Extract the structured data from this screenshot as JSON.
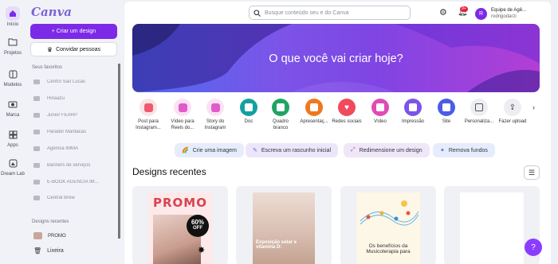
{
  "rail": [
    {
      "label": "Início",
      "icon": "home-icon"
    },
    {
      "label": "Projetos",
      "icon": "folder-icon"
    },
    {
      "label": "Modelos",
      "icon": "templates-icon"
    },
    {
      "label": "Marca",
      "icon": "brand-icon"
    },
    {
      "label": "Apps",
      "icon": "apps-icon"
    },
    {
      "label": "Dream Lab",
      "icon": "dream-lab-icon"
    }
  ],
  "sidebar": {
    "logo": "Canva",
    "create_label": "+ Criar um design",
    "invite_label": "Convidar pessoas",
    "favorites_heading": "Seus favoritos",
    "favorites": [
      "Centro São Lucas",
      "Hinaazu",
      "Junior FEARP",
      "Parador Maritacas",
      "Agência IMMA",
      "Banners de serviços",
      "E-BOOK AGÊNCIA IM...",
      "Central Brew"
    ],
    "recents_heading": "Designs recentes",
    "recent_item": "PROMO",
    "trash_label": "Lixeira"
  },
  "header": {
    "search_placeholder": "Busque conteúdo seu e do Canva",
    "notification_badge": "9+",
    "avatar_letter": "R",
    "team_name": "Equipe de Agê...",
    "user_name": "rodrigodarzi"
  },
  "hero": {
    "title": "O que você vai criar hoje?"
  },
  "categories": [
    {
      "label": "Post para Instagram...",
      "color": "#ef5a6f",
      "icon": "instagram-post-icon"
    },
    {
      "label": "Vídeo para Reels do...",
      "color": "#e05bc9",
      "icon": "reels-video-icon"
    },
    {
      "label": "Story do Instagram",
      "color": "#e05bc9",
      "icon": "story-icon"
    },
    {
      "label": "Doc",
      "color": "#14a0a0",
      "icon": "doc-icon"
    },
    {
      "label": "Quadro branco",
      "color": "#1fa463",
      "icon": "whiteboard-icon"
    },
    {
      "label": "Apresentaç...",
      "color": "#f0771f",
      "icon": "presentation-icon"
    },
    {
      "label": "Redes sociais",
      "color": "#f04a5c",
      "icon": "social-media-icon"
    },
    {
      "label": "Vídeo",
      "color": "#e04bb5",
      "icon": "video-icon"
    },
    {
      "label": "Impressão",
      "color": "#7b54e8",
      "icon": "print-icon"
    },
    {
      "label": "Site",
      "color": "#4a5ce8",
      "icon": "website-icon"
    },
    {
      "label": "Personaliza...",
      "color": "#d7d9de",
      "icon": "custom-size-icon"
    },
    {
      "label": "Fazer upload",
      "color": "#d7d9de",
      "icon": "upload-icon"
    }
  ],
  "chips": [
    {
      "label": "Crie uma imagem",
      "bg": "#e6ecfb",
      "icon": "rainbow-icon"
    },
    {
      "label": "Escreva um rascunho inicial",
      "bg": "#ece6fa",
      "icon": "pen-icon"
    },
    {
      "label": "Redimensione um design",
      "bg": "#efe6f7",
      "icon": "resize-icon"
    },
    {
      "label": "Remova fundos",
      "bg": "#e6ecfb",
      "icon": "magic-icon"
    }
  ],
  "recent": {
    "title": "Designs recentes",
    "cards": [
      {
        "promo": "PROMO",
        "discount_big": "60%",
        "discount_small": "OFF"
      },
      {
        "caption": "Exposição solar e vitamina D:"
      },
      {
        "caption": "Os benefícios da Musicoterapia para"
      },
      {
        "caption": ""
      }
    ]
  },
  "help_label": "?",
  "colors": {
    "accent": "#7d2ae8",
    "badge": "#e0243b"
  }
}
